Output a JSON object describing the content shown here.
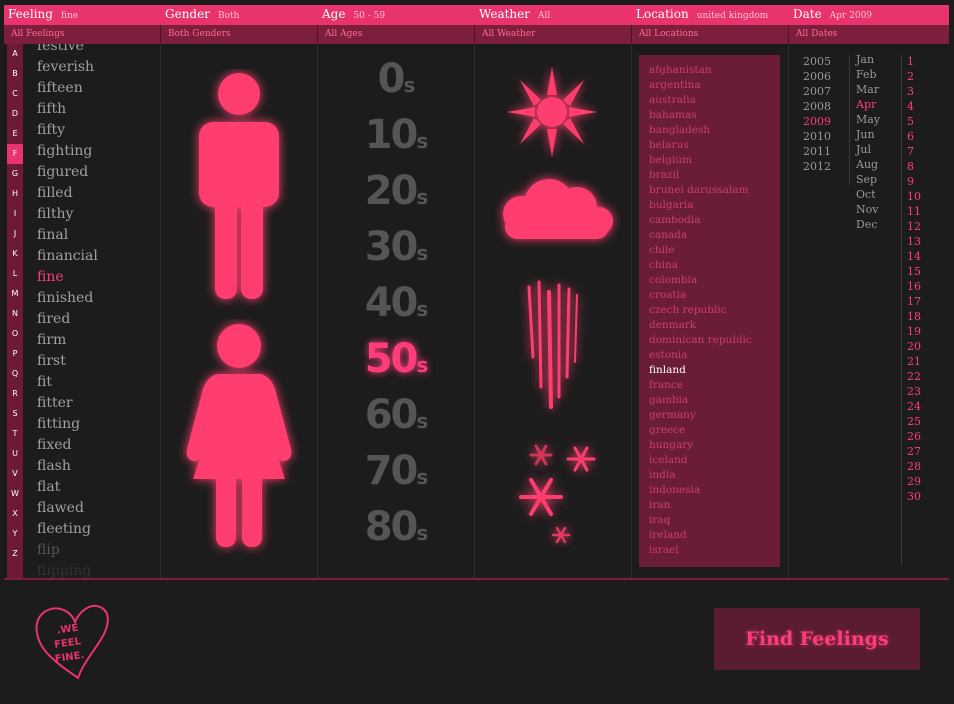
{
  "header": [
    {
      "label": "Feeling",
      "value": "fine"
    },
    {
      "label": "Gender",
      "value": "Both"
    },
    {
      "label": "Age",
      "value": "50 - 59"
    },
    {
      "label": "Weather",
      "value": "All"
    },
    {
      "label": "Location",
      "value": "united kingdom"
    },
    {
      "label": "Date",
      "value": "Apr 2009"
    }
  ],
  "subheader": [
    "All Feelings",
    "Both Genders",
    "All Ages",
    "All Weather",
    "All Locations",
    "All Dates"
  ],
  "feelings": {
    "letters": [
      "A",
      "B",
      "C",
      "D",
      "E",
      "F",
      "G",
      "H",
      "I",
      "J",
      "K",
      "L",
      "M",
      "N",
      "O",
      "P",
      "Q",
      "R",
      "S",
      "T",
      "U",
      "V",
      "W",
      "X",
      "Y",
      "Z"
    ],
    "active_letter": "F",
    "words": [
      "festive",
      "feverish",
      "fifteen",
      "fifth",
      "fifty",
      "fighting",
      "figured",
      "filled",
      "filthy",
      "final",
      "financial",
      "fine",
      "finished",
      "fired",
      "firm",
      "first",
      "fit",
      "fitter",
      "fitting",
      "fixed",
      "flash",
      "flat",
      "flawed",
      "fleeting",
      "flip",
      "flipping"
    ],
    "selected": "fine"
  },
  "genders": [
    "male-icon",
    "female-icon"
  ],
  "ages": {
    "items": [
      {
        "n": "0",
        "s": "s"
      },
      {
        "n": "10",
        "s": "s"
      },
      {
        "n": "20",
        "s": "s"
      },
      {
        "n": "30",
        "s": "s"
      },
      {
        "n": "40",
        "s": "s"
      },
      {
        "n": "50",
        "s": "s"
      },
      {
        "n": "60",
        "s": "s"
      },
      {
        "n": "70",
        "s": "s"
      },
      {
        "n": "80",
        "s": "s"
      }
    ],
    "selected": "50"
  },
  "weather": [
    "sun-icon",
    "cloud-icon",
    "rain-icon",
    "snow-icon"
  ],
  "locations": {
    "items": [
      "afghanistan",
      "argentina",
      "australia",
      "bahamas",
      "bangladesh",
      "belarus",
      "belgium",
      "brazil",
      "brunei darussalam",
      "bulgaria",
      "cambodia",
      "canada",
      "chile",
      "china",
      "colombia",
      "croatia",
      "czech republic",
      "denmark",
      "dominican republic",
      "estonia",
      "finland",
      "france",
      "gambia",
      "germany",
      "greece",
      "hungary",
      "iceland",
      "india",
      "indonesia",
      "iran",
      "iraq",
      "ireland",
      "israel"
    ],
    "selected": "finland"
  },
  "dates": {
    "years": [
      "2005",
      "2006",
      "2007",
      "2008",
      "2009",
      "2010",
      "2011",
      "2012"
    ],
    "selected_year": "2009",
    "months": [
      "Jan",
      "Feb",
      "Mar",
      "Apr",
      "May",
      "Jun",
      "Jul",
      "Aug",
      "Sep",
      "Oct",
      "Nov",
      "Dec"
    ],
    "selected_month": "Apr",
    "days": [
      "1",
      "2",
      "3",
      "4",
      "5",
      "6",
      "7",
      "8",
      "9",
      "10",
      "11",
      "12",
      "13",
      "14",
      "15",
      "16",
      "17",
      "18",
      "19",
      "20",
      "21",
      "22",
      "23",
      "24",
      "25",
      "26",
      "27",
      "28",
      "29",
      "30"
    ]
  },
  "footer": {
    "logo_lines": [
      ".WE",
      "FEEL",
      "FINE."
    ],
    "button": "Find Feelings"
  },
  "colors": {
    "accent": "#e8336d",
    "glow": "#ff3d7a",
    "dark_accent": "#6a1d35",
    "background": "#1c1c1c"
  }
}
